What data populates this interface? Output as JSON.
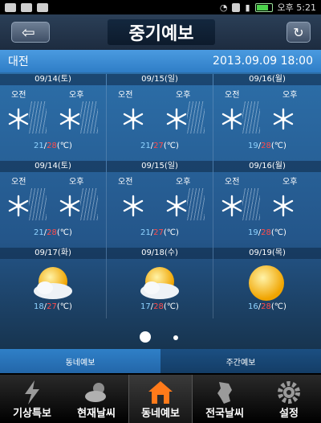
{
  "status_bar": {
    "time": "오후 5:21"
  },
  "header": {
    "title": "중기예보",
    "back_icon": "back-arrow-icon",
    "refresh_icon": "refresh-icon"
  },
  "location": {
    "name": "대전",
    "datetime": "2013.09.09 18:00"
  },
  "labels": {
    "am": "오전",
    "pm": "오후",
    "unit": "(℃)",
    "sep": "/"
  },
  "rows": [
    {
      "days": [
        {
          "date": "09/14(토)",
          "am_weather": "snow-rain",
          "pm_weather": "snow-rain",
          "min": "21",
          "max": "28"
        },
        {
          "date": "09/15(일)",
          "am_weather": "snow",
          "pm_weather": "snow-rain",
          "min": "21",
          "max": "27"
        },
        {
          "date": "09/16(월)",
          "am_weather": "snow-rain",
          "pm_weather": "snow",
          "min": "19",
          "max": "28"
        }
      ]
    },
    {
      "days": [
        {
          "date": "09/14(토)",
          "am_weather": "snow-rain",
          "pm_weather": "snow-rain",
          "min": "21",
          "max": "28"
        },
        {
          "date": "09/15(일)",
          "am_weather": "snow",
          "pm_weather": "snow-rain",
          "min": "21",
          "max": "27"
        },
        {
          "date": "09/16(월)",
          "am_weather": "snow-rain",
          "pm_weather": "snow",
          "min": "19",
          "max": "28"
        }
      ]
    }
  ],
  "row3": [
    {
      "date": "09/17(화)",
      "weather": "sun-cloud",
      "min": "18",
      "max": "27"
    },
    {
      "date": "09/18(수)",
      "weather": "sun-cloud",
      "min": "17",
      "max": "28"
    },
    {
      "date": "09/19(목)",
      "weather": "sun",
      "min": "16",
      "max": "28"
    }
  ],
  "pager": {
    "current": 1,
    "total": 2
  },
  "subtabs": [
    {
      "label": "동네예보",
      "active": true
    },
    {
      "label": "주간예보",
      "active": false
    }
  ],
  "bottom_nav": [
    {
      "label": "기상특보",
      "icon": "lightning-icon",
      "active": false
    },
    {
      "label": "현재날씨",
      "icon": "sun-cloud-icon",
      "active": false
    },
    {
      "label": "동네예보",
      "icon": "home-icon",
      "active": true
    },
    {
      "label": "전국날씨",
      "icon": "map-icon",
      "active": false
    },
    {
      "label": "설정",
      "icon": "gear-icon",
      "active": false
    }
  ],
  "colors": {
    "min_temp": "#8fd3ff",
    "max_temp": "#ff4b4b",
    "location_bar": "#3f8fd8",
    "active_nav_icon": "#ff7a1a"
  }
}
